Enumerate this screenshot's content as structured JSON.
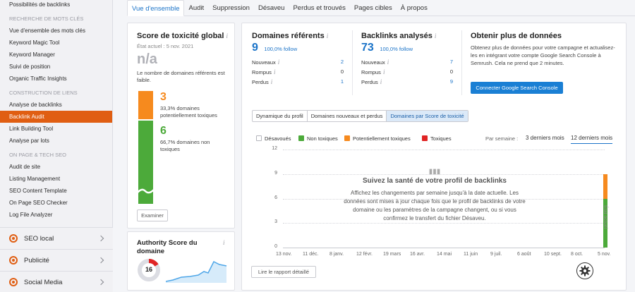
{
  "sidebar": {
    "top_item": "Possibilités de backlinks",
    "section1": "Recherche de mots clés",
    "keyword_items": [
      "Vue d'ensemble des mots clés",
      "Keyword Magic Tool",
      "Keyword Manager",
      "Suivi de position",
      "Organic Traffic Insights"
    ],
    "section2": "Construction de liens",
    "link_items": [
      "Analyse de backlinks",
      "Backlink Audit",
      "Link Building Tool",
      "Analyse par lots"
    ],
    "section3": "On Page & Tech SEO",
    "onpage_items": [
      "Audit de site",
      "Listing Management",
      "SEO Content Template",
      "On Page SEO Checker",
      "Log File Analyzer"
    ],
    "groups": [
      "SEO local",
      "Publicité",
      "Social Media"
    ]
  },
  "tabs": [
    "Vue d'ensemble",
    "Audit",
    "Suppression",
    "Désaveu",
    "Perdus et trouvés",
    "Pages cibles",
    "À propos"
  ],
  "toxicity": {
    "title": "Score de toxicité global",
    "state": "État actuel : 5 nov. 2021",
    "score": "n/a",
    "note": "Le nombre de domaines référents est faible.",
    "orange_count": "3",
    "orange_text": "33,3% domaines potentiellement toxiques",
    "green_count": "6",
    "green_text": "66,7% domaines non toxiques",
    "button": "Examiner"
  },
  "authority": {
    "title": "Authority Score du domaine",
    "value": "16"
  },
  "referring": {
    "title": "Domaines référents",
    "count": "9",
    "follow": "100,0% follow",
    "rows": [
      {
        "label": "Nouveaux",
        "value": "2"
      },
      {
        "label": "Rompus",
        "value": "0"
      },
      {
        "label": "Perdus",
        "value": "1"
      }
    ]
  },
  "backlinks": {
    "title": "Backlinks analysés",
    "count": "73",
    "follow": "100,0% follow",
    "rows": [
      {
        "label": "Nouveaux",
        "value": "7"
      },
      {
        "label": "Rompus",
        "value": "0"
      },
      {
        "label": "Perdus",
        "value": "9"
      }
    ]
  },
  "more_data": {
    "title": "Obtenir plus de données",
    "text": "Obtenez plus de données pour votre campagne et actualisez-les en intégrant votre compte Google Search Console à Semrush. Cela ne prend que 2 minutes.",
    "button": "Connecter Google Search Console"
  },
  "chart_tabs": [
    "Dynamique du profil",
    "Domaines nouveaux et perdus",
    "Domaines par Score de toxicité"
  ],
  "legend": [
    "Désavoués",
    "Non toxiques",
    "Potentiellement toxiques",
    "Toxiques"
  ],
  "period": {
    "label": "Par semaine :",
    "options": [
      "3 derniers mois",
      "12 derniers mois"
    ]
  },
  "empty_state": {
    "title": "Suivez la santé de votre profil de backlinks",
    "text": "Affichez les changements par semaine jusqu'à la date actuelle. Les données sont mises à jour chaque fois que le profil de backlinks de votre domaine ou les paramètres de la campagne changent, ou si vous confirmez le transfert du fichier Désaveu."
  },
  "current_state_label": "État actuel",
  "report_button": "Lire le rapport détaillé",
  "colors": {
    "orange": "#f68a1e",
    "green": "#4caa3a",
    "red": "#e02424",
    "blue": "#1a73c8",
    "accent": "#e05e12"
  },
  "chart_data": {
    "type": "bar",
    "categories": [
      "13 nov.",
      "11 déc.",
      "8 janv.",
      "12 févr.",
      "19 mars",
      "16 avr.",
      "14 mai",
      "11 juin",
      "9 juil.",
      "6 août",
      "10 sept.",
      "8 oct.",
      "5 nov."
    ],
    "ylim": [
      0,
      12
    ],
    "yticks": [
      "0",
      "3",
      "6",
      "9",
      "12"
    ],
    "series": [
      {
        "name": "Non toxiques",
        "values": [
          null,
          null,
          null,
          null,
          null,
          null,
          null,
          null,
          null,
          null,
          null,
          null,
          6
        ]
      },
      {
        "name": "Potentiellement toxiques",
        "values": [
          null,
          null,
          null,
          null,
          null,
          null,
          null,
          null,
          null,
          null,
          null,
          null,
          3
        ]
      }
    ]
  }
}
